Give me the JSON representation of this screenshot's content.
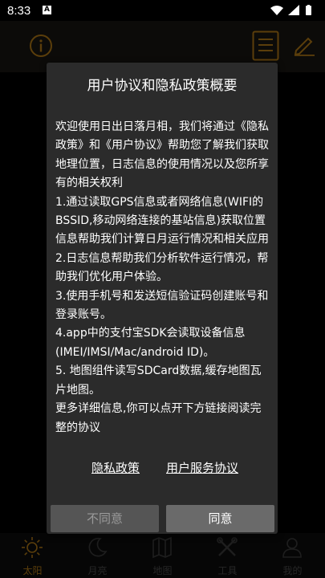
{
  "status_bar": {
    "time": "8:33",
    "badge": "A"
  },
  "dialog": {
    "title": "用户协议和隐私政策概要",
    "body": "欢迎使用日出日落月相，我们将通过《隐私政策》和《用户协议》帮助您了解我们获取地理位置，日志信息的使用情况以及您所享有的相关权利\n1.通过读取GPS信息或者网络信息(WIFI的BSSID,移动网络连接的基站信息)获取位置信息帮助我们计算日月运行情况和相关应用\n2.日志信息帮助我们分析软件运行情况，帮助我们优化用户体验。\n3.使用手机号和发送短信验证码创建账号和登录账号。\n4.app中的支付宝SDK会读取设备信息(IMEI/IMSI/Mac/android ID)。\n5. 地图组件读写SDCard数据,缓存地图瓦片地图。\n更多详细信息,你可以点开下方链接阅读完整的协议",
    "link_privacy": "隐私政策",
    "link_service": "用户服务协议",
    "disagree_label": "不同意",
    "agree_label": "同意"
  },
  "bottom_nav": {
    "items": [
      {
        "label": "太阳",
        "icon": "sun-icon",
        "active": true
      },
      {
        "label": "月亮",
        "icon": "moon-icon",
        "active": false
      },
      {
        "label": "地图",
        "icon": "map-icon",
        "active": false
      },
      {
        "label": "工具",
        "icon": "tools-icon",
        "active": false
      },
      {
        "label": "我的",
        "icon": "user-icon",
        "active": false
      }
    ]
  },
  "colors": {
    "accent": "#c98a1a",
    "dialog_bg": "#2b2b2b"
  }
}
